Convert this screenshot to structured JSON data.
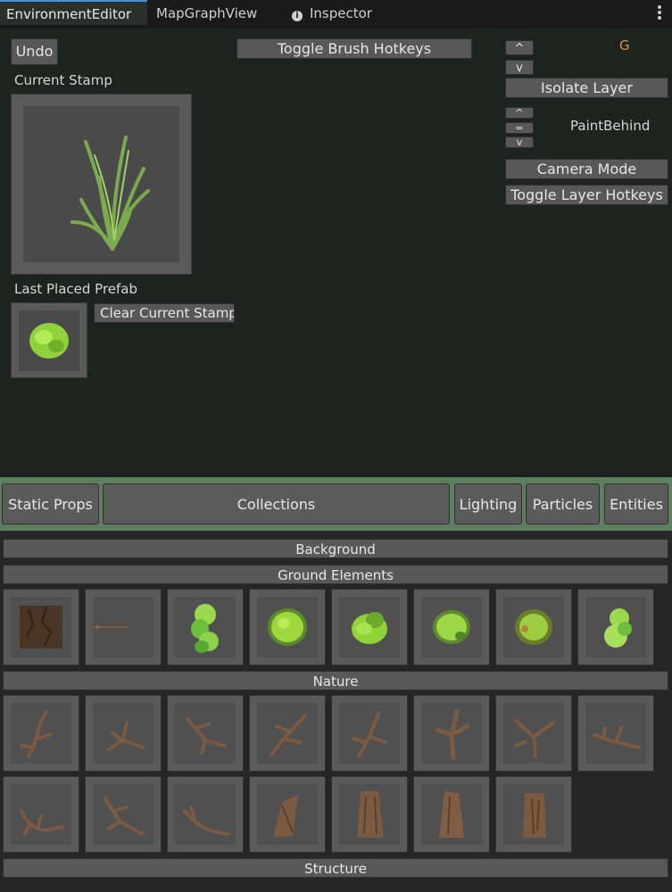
{
  "tabs": [
    {
      "label": "EnvironmentEditor",
      "active": true
    },
    {
      "label": "MapGraphView",
      "active": false
    },
    {
      "label": "Inspector",
      "active": false
    }
  ],
  "toolbar": {
    "undo": "Undo",
    "toggle_brush_hotkeys": "Toggle Brush Hotkeys",
    "current_stamp": "Current Stamp",
    "last_placed_prefab": "Last Placed Prefab",
    "clear_current_stamp": "Clear Current Stamp"
  },
  "layer_panel": {
    "up_arrow": "^",
    "down_arrow": "v",
    "equals": "=",
    "layer_letter": "G",
    "layer_letter_color": "#e8913a",
    "isolate_layer": "Isolate Layer",
    "paint_behind": "PaintBehind",
    "camera_mode": "Camera Mode",
    "toggle_layer_hotkeys": "Toggle Layer Hotkeys"
  },
  "categories": [
    "Static Props",
    "Collections",
    "Lighting",
    "Particles",
    "Entities"
  ],
  "sections": {
    "background": "Background",
    "ground_elements": "Ground Elements",
    "nature": "Nature",
    "structure": "Structure"
  },
  "ground_tiles": [
    "dirt-tile-icon",
    "stick-icon",
    "grass-clump-icon",
    "moss-patch-icon",
    "bush-icon",
    "bush-icon",
    "moss-patch-icon",
    "bush-icon"
  ],
  "nature_tiles": [
    "branch-icon",
    "branch-icon",
    "branch-icon",
    "branch-icon",
    "branch-icon",
    "branch-icon",
    "branch-icon",
    "branch-icon",
    "branch-icon",
    "branch-icon",
    "branch-icon",
    "log-icon",
    "stump-icon",
    "stump-icon",
    "stump-icon"
  ],
  "colors": {
    "accent_tab": "#4b8bd6",
    "category_bar": "#5f7d5f",
    "panel_bg": "#1d231e"
  }
}
